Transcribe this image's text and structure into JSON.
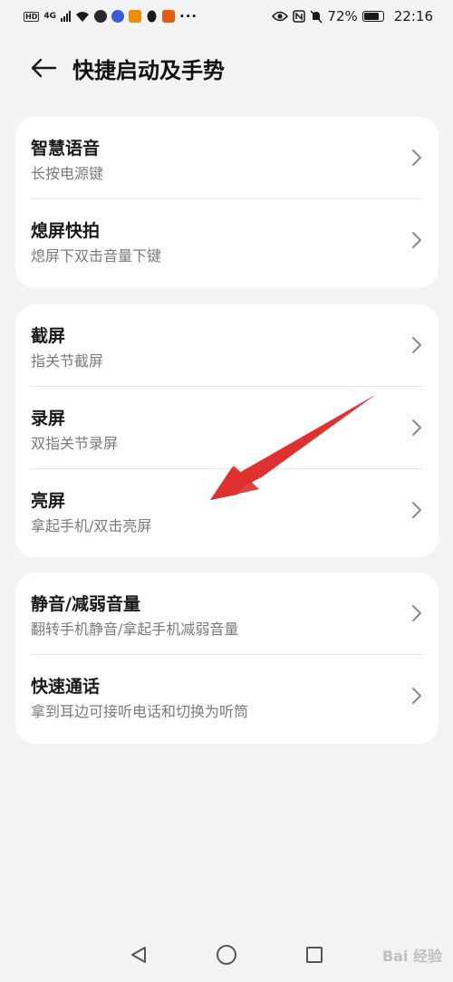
{
  "status_bar": {
    "network_badge": "HD",
    "signal_label": "4G",
    "battery_percent": "72%",
    "time": "22:16",
    "icons": [
      "wifi-icon",
      "app-icon",
      "music-icon",
      "notification-icon",
      "qq-icon",
      "app-icon",
      "eye-icon",
      "nfc-icon",
      "mute-icon",
      "battery-icon"
    ]
  },
  "header": {
    "back_icon": "back-arrow-icon",
    "title": "快捷启动及手势"
  },
  "groups": [
    {
      "items": [
        {
          "title": "智慧语音",
          "subtitle": "长按电源键"
        },
        {
          "title": "熄屏快拍",
          "subtitle": "熄屏下双击音量下键"
        }
      ]
    },
    {
      "items": [
        {
          "title": "截屏",
          "subtitle": "指关节截屏"
        },
        {
          "title": "录屏",
          "subtitle": "双指关节录屏"
        },
        {
          "title": "亮屏",
          "subtitle": "拿起手机/双击亮屏"
        }
      ]
    },
    {
      "items": [
        {
          "title": "静音/减弱音量",
          "subtitle": "翻转手机静音/拿起手机减弱音量"
        },
        {
          "title": "快速通话",
          "subtitle": "拿到耳边可接听电话和切换为听筒"
        }
      ]
    }
  ],
  "navbar": {
    "icons": [
      "back-triangle-icon",
      "home-circle-icon",
      "recents-square-icon"
    ]
  },
  "watermark": "Bai 经验",
  "colors": {
    "background": "#f1f3f5",
    "card": "#ffffff",
    "annotation_arrow": "#e03131"
  }
}
